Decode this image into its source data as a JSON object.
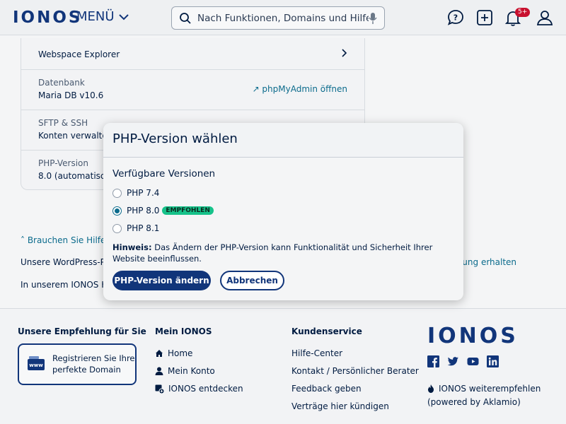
{
  "header": {
    "logo": "IONOS",
    "menu_label": "MENÜ",
    "search_placeholder": "Nach Funktionen, Domains und Hilfe su...",
    "notification_badge": "5+"
  },
  "card": {
    "rows": [
      {
        "value": "Webspace Explorer"
      },
      {
        "label": "Datenbank",
        "value": "Maria DB v10.6",
        "link": "↗ phpMyAdmin öffnen"
      },
      {
        "label": "SFTP & SSH",
        "value": "Konten verwalten"
      },
      {
        "label": "PHP-Version",
        "value": "8.0 (automatische"
      }
    ]
  },
  "help": {
    "toggle": "˄ Brauchen Sie Hilfe?",
    "line1": "Unsere WordPress-Pro",
    "line2": "In unserem IONOS Hilf",
    "right_link": "zung erhalten"
  },
  "modal": {
    "title": "PHP-Version wählen",
    "subtitle": "Verfügbare Versionen",
    "options": [
      {
        "label": "PHP 7.4",
        "checked": false
      },
      {
        "label": "PHP 8.0",
        "checked": true,
        "badge": "EMPFOHLEN"
      },
      {
        "label": "PHP 8.1",
        "checked": false
      }
    ],
    "note_bold": "Hinweis:",
    "note_text": " Das Ändern der PHP-Version kann Funktionalität und Sicherheit Ihrer Website beeinflussen.",
    "primary_button": "PHP-Version ändern",
    "secondary_button": "Abbrechen"
  },
  "footer": {
    "col1_title": "Unsere Empfehlung für Sie",
    "promo_text": "Registrieren Sie Ihre perfekte Domain",
    "promo_icon_text": "www",
    "col2_title": "Mein IONOS",
    "col2_links": [
      "Home",
      "Mein Konto",
      "IONOS entdecken"
    ],
    "col3_title": "Kundenservice",
    "col3_links": [
      "Hilfe-Center",
      "Kontakt / Persönlicher Berater",
      "Feedback geben",
      "Verträge hier kündigen"
    ],
    "logo": "IONOS",
    "recommend_line1": "IONOS weiterempfehlen",
    "recommend_line2": "(powered by Aklamio)"
  },
  "colors": {
    "brand": "#11357a",
    "link": "#0b6b8c",
    "badge_green": "#16c28a",
    "notification_red": "#c8102e"
  }
}
